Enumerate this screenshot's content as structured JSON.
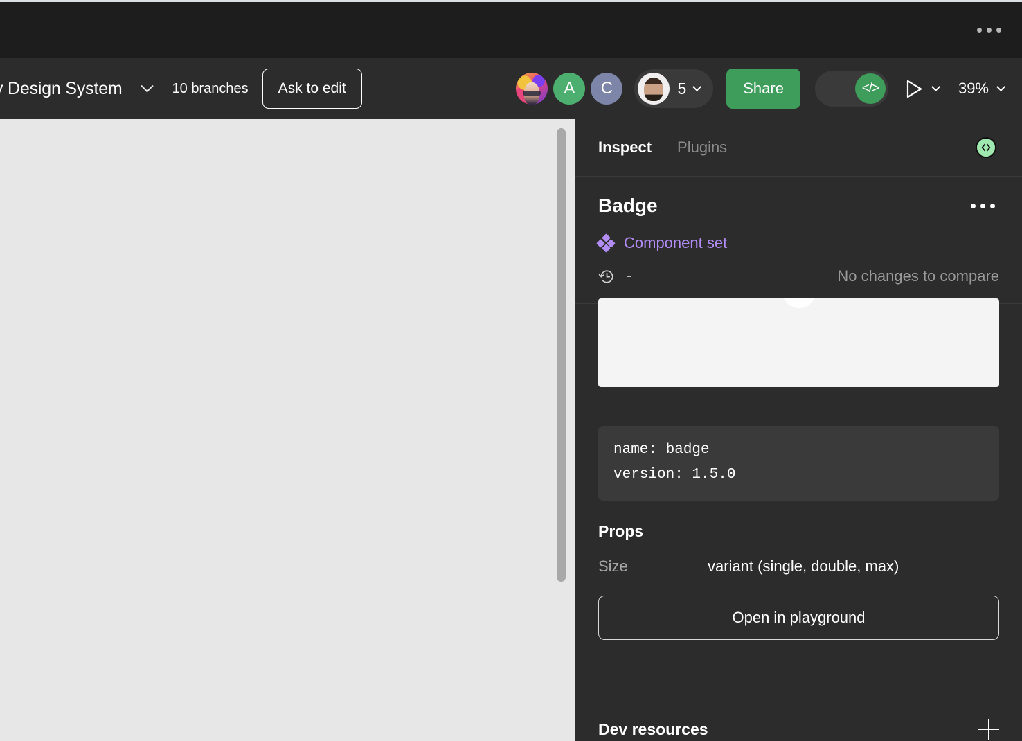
{
  "tabstrip": {
    "overflow_label": "tabs-overflow-menu"
  },
  "toolbar": {
    "file_name": "y Design System",
    "branches": "10 branches",
    "ask_to_edit": "Ask to edit",
    "share": "Share",
    "users_count": "5",
    "zoom": "39%",
    "devmode_icon_label": "</>",
    "avatars": [
      {
        "name": "avatar-illustrated",
        "initial": "",
        "color": "#e8457c"
      },
      {
        "name": "avatar-a",
        "initial": "A",
        "color": "#4caf6f"
      },
      {
        "name": "avatar-c",
        "initial": "C",
        "color": "#7d86a8"
      }
    ]
  },
  "panel": {
    "tabs": [
      {
        "label": "Inspect",
        "active": true
      },
      {
        "label": "Plugins",
        "active": false
      }
    ],
    "selection": {
      "title": "Badge",
      "type_label": "Component set",
      "history_value": "-",
      "compare_status": "No changes to compare"
    },
    "code": "name: badge\nversion: 1.5.0",
    "props": {
      "title": "Props",
      "rows": [
        {
          "key": "Size",
          "value": "variant (single, double, max)"
        }
      ]
    },
    "playground_button": "Open in playground",
    "dev_resources": {
      "title": "Dev resources"
    }
  },
  "colors": {
    "accent_green": "#3f9d5c",
    "component_purple": "#b38df7",
    "panel_bg": "#2c2c2c",
    "canvas_bg": "#e7e7e7",
    "codegen_green": "#9fe8af"
  }
}
